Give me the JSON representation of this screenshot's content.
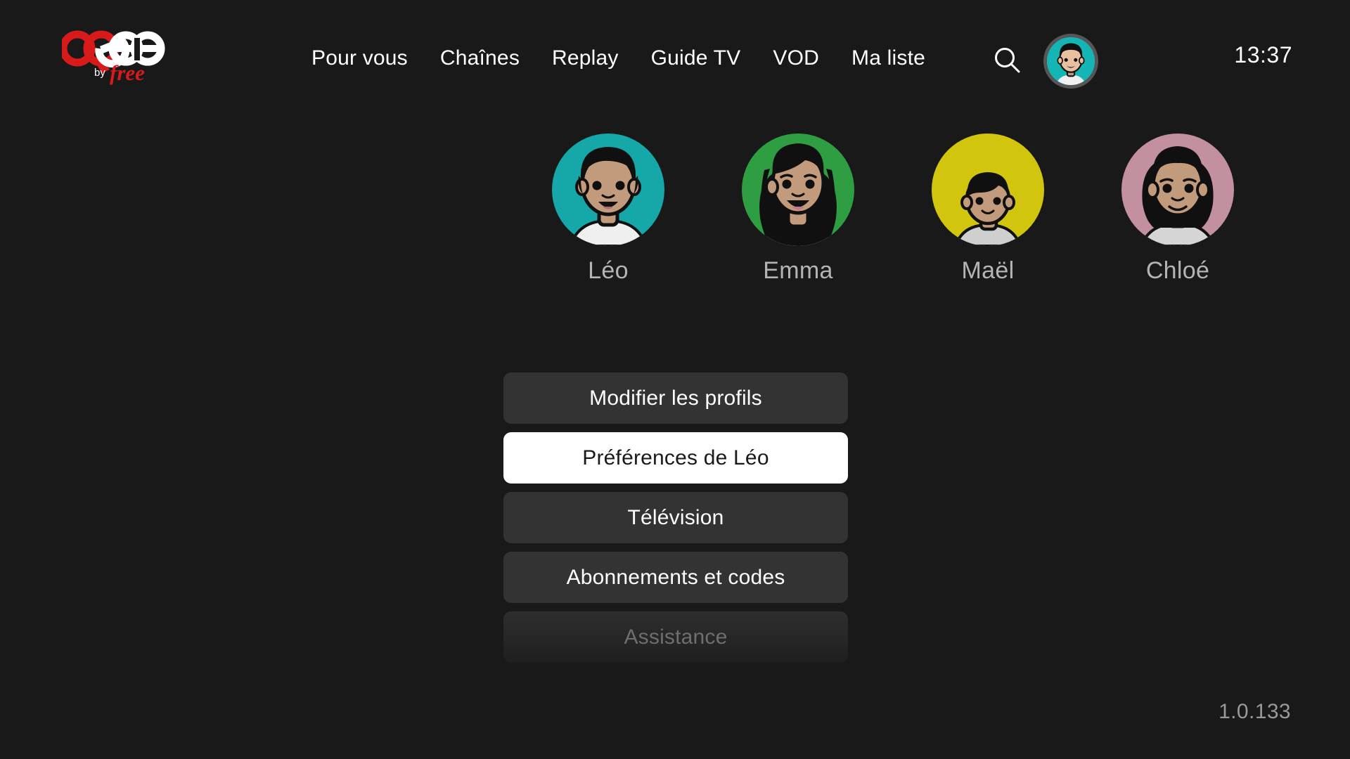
{
  "app": {
    "background_color": "#191919",
    "version": "1.0.133"
  },
  "header": {
    "logo": {
      "name": "oqee-by-free-logo",
      "primary_text": "OQ",
      "secondary_text": "ee",
      "by_text": "by",
      "brand_text": "free",
      "primary_color": "#d81a1a",
      "secondary_color": "#ffffff"
    },
    "nav_items": [
      {
        "id": "pour-vous",
        "label": "Pour vous"
      },
      {
        "id": "chaines",
        "label": "Chaînes"
      },
      {
        "id": "replay",
        "label": "Replay"
      },
      {
        "id": "guide-tv",
        "label": "Guide TV"
      },
      {
        "id": "vod",
        "label": "VOD"
      },
      {
        "id": "ma-liste",
        "label": "Ma liste"
      }
    ],
    "search_icon": "search-icon",
    "avatar": {
      "name": "header-avatar",
      "profile": "Léo",
      "background_color": "#16b5b5",
      "ring_color": "#565656"
    },
    "clock": "13:37"
  },
  "profiles": [
    {
      "id": "leo",
      "name": "Léo",
      "avatar_bg": "#16a8a8",
      "hair": "#101010",
      "skin": "#c29a7c",
      "shirt": "#e6e6e6",
      "type": "short-hair-male"
    },
    {
      "id": "emma",
      "name": "Emma",
      "avatar_bg": "#2f9e43",
      "hair": "#101010",
      "skin": "#c29a7c",
      "shirt": "#e6e6e6",
      "type": "long-hair-female"
    },
    {
      "id": "mael",
      "name": "Maël",
      "avatar_bg": "#d2c50d",
      "hair": "#101010",
      "skin": "#c29a7c",
      "shirt": "#cfcfcf",
      "type": "child-male"
    },
    {
      "id": "chloe",
      "name": "Chloé",
      "avatar_bg": "#c2909f",
      "hair": "#101010",
      "skin": "#c29a7c",
      "shirt": "#d5d5d5",
      "type": "bob-hair-female"
    }
  ],
  "menu": {
    "items": [
      {
        "id": "modifier-les-profils",
        "label": "Modifier les profils",
        "state": "normal"
      },
      {
        "id": "preferences-de-leo",
        "label": "Préférences de Léo",
        "state": "selected"
      },
      {
        "id": "television",
        "label": "Télévision",
        "state": "normal"
      },
      {
        "id": "abonnements-et-codes",
        "label": "Abonnements et codes",
        "state": "normal"
      },
      {
        "id": "assistance",
        "label": "Assistance",
        "state": "faded"
      }
    ]
  }
}
